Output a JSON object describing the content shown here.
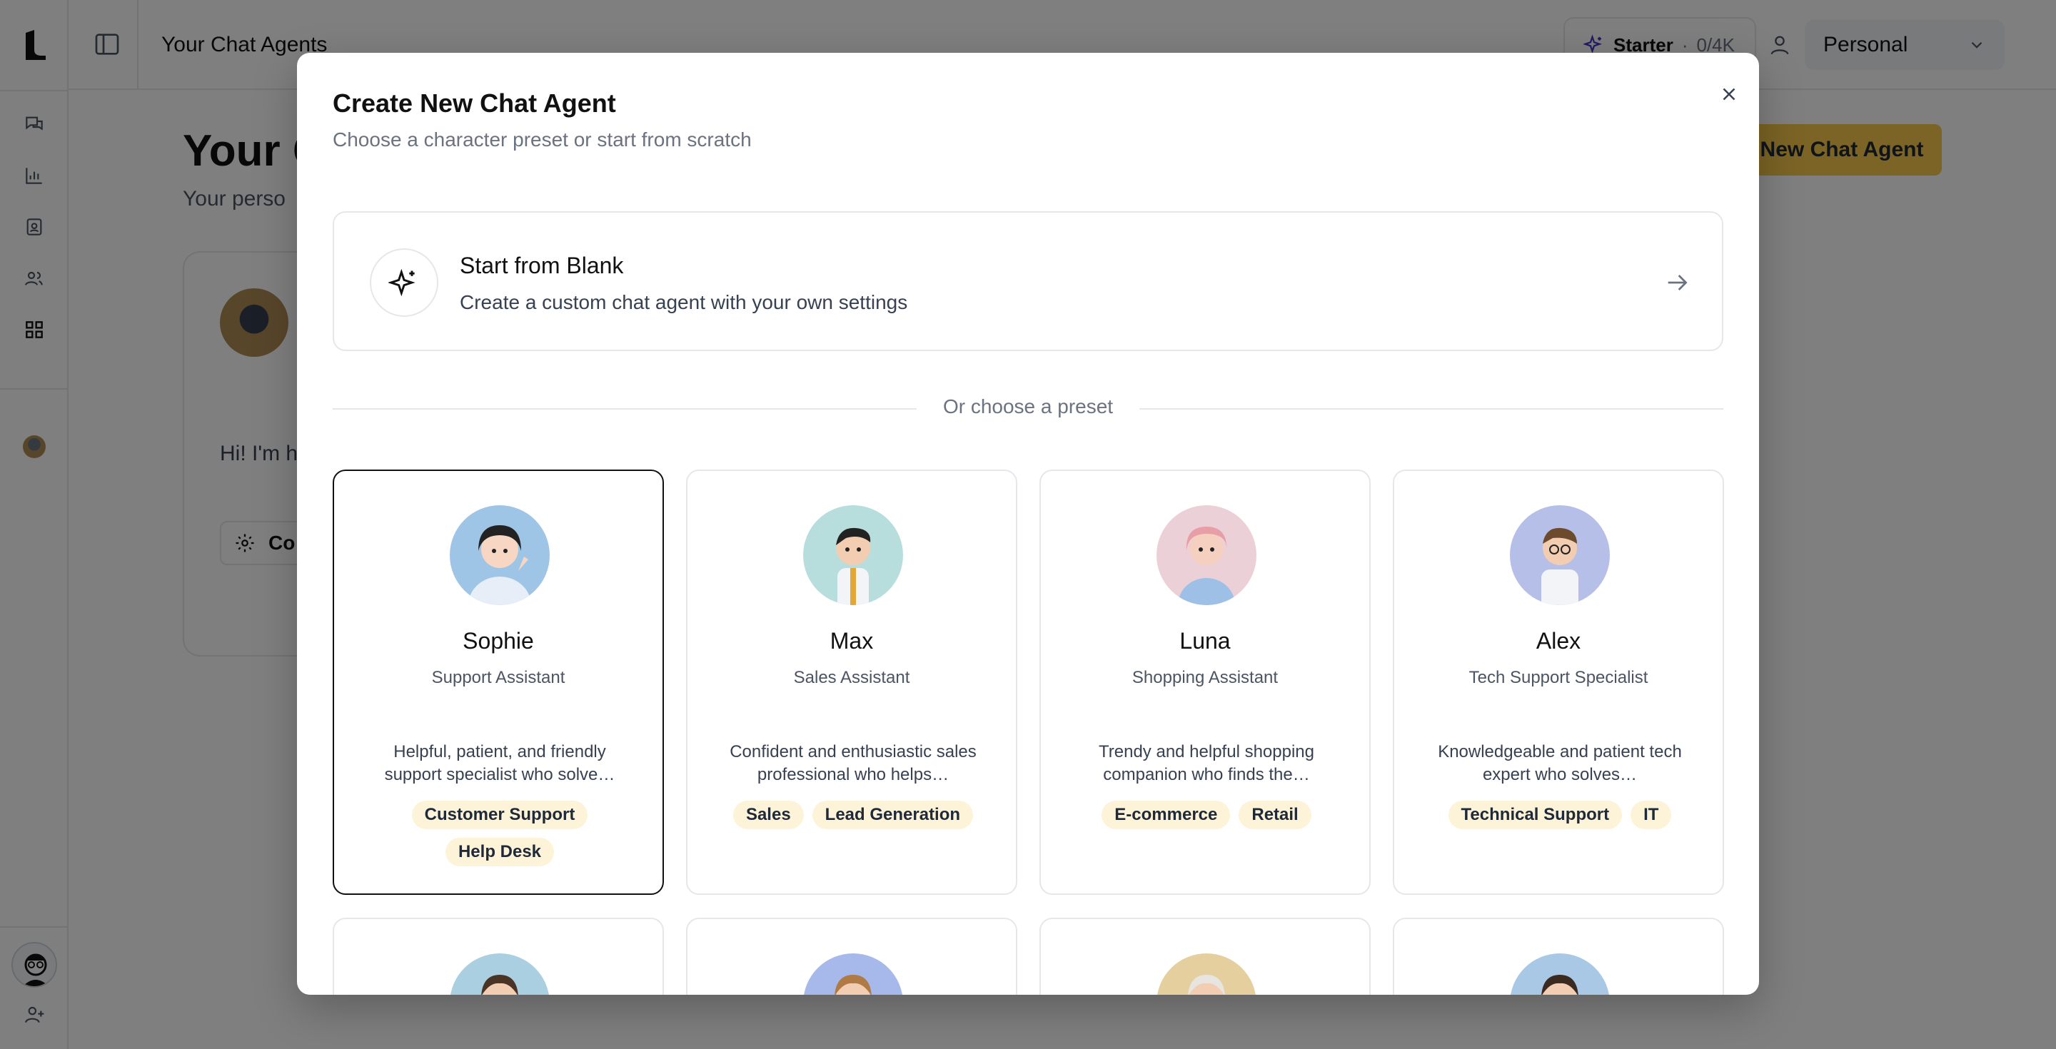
{
  "app": {
    "topbar_title": "Your Chat Agents",
    "plan_name": "Starter",
    "plan_sep": "·",
    "plan_usage": "0/4K",
    "workspace": "Personal"
  },
  "background": {
    "page_title": "Your C",
    "page_subtitle": "Your perso",
    "new_agent_label": "New Chat Agent",
    "agent_greeting": "Hi! I'm h today?",
    "configure_label": "Co"
  },
  "modal": {
    "title": "Create New Chat Agent",
    "subtitle": "Choose a character preset or start from scratch",
    "blank": {
      "title": "Start from Blank",
      "description": "Create a custom chat agent with your own settings"
    },
    "divider_label": "Or choose a preset",
    "presets": [
      {
        "name": "Sophie",
        "role": "Support Assistant",
        "description": "Helpful, patient, and friendly support specialist who solve…",
        "tags": [
          "Customer Support",
          "Help Desk"
        ],
        "avatar_bg": "#9ec4e6",
        "selected": true
      },
      {
        "name": "Max",
        "role": "Sales Assistant",
        "description": "Confident and enthusiastic sales professional who helps…",
        "tags": [
          "Sales",
          "Lead Generation"
        ],
        "avatar_bg": "#b7dedd",
        "selected": false
      },
      {
        "name": "Luna",
        "role": "Shopping Assistant",
        "description": "Trendy and helpful shopping companion who finds the…",
        "tags": [
          "E-commerce",
          "Retail"
        ],
        "avatar_bg": "#ecd0d8",
        "selected": false
      },
      {
        "name": "Alex",
        "role": "Tech Support Specialist",
        "description": "Knowledgeable and patient tech expert who solves…",
        "tags": [
          "Technical Support",
          "IT"
        ],
        "avatar_bg": "#b6bfe8",
        "selected": false
      }
    ],
    "row2_avatar_bgs": [
      "#a9cfe0",
      "#a7b9ea",
      "#e6cf9e",
      "#a9c8e6"
    ]
  },
  "colors": {
    "accent": "#f6c94b",
    "tag_bg": "#fdf3d8",
    "overlay": "rgba(0,0,0,0.5)"
  }
}
